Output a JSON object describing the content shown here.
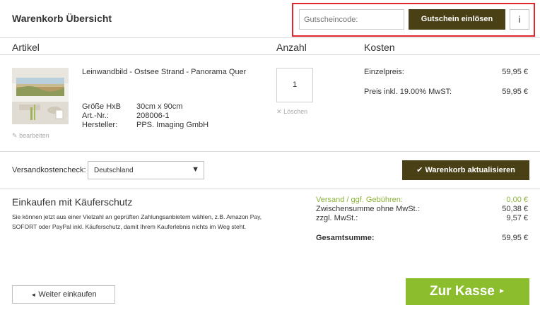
{
  "header": {
    "title": "Warenkorb Übersicht",
    "coupon_placeholder": "Gutscheincode:",
    "coupon_button": "Gutschein einlösen",
    "info_button": "i"
  },
  "columns": {
    "article": "Artikel",
    "quantity": "Anzahl",
    "costs": "Kosten"
  },
  "product": {
    "name": "Leinwandbild - Ostsee Strand - Panorama Quer",
    "specs": [
      {
        "label": "Größe HxB",
        "value": "30cm x 90cm"
      },
      {
        "label": "Art.-Nr.:",
        "value": "208006-1"
      },
      {
        "label": "Hersteller:",
        "value": "PPS. Imaging GmbH"
      }
    ],
    "edit_label": "bearbeiten",
    "quantity": "1",
    "delete_label": "Löschen",
    "unit_price_label": "Einzelpreis:",
    "unit_price": "59,95 €",
    "price_incl_label": "Preis inkl. 19.00% MwST:",
    "price_incl": "59,95 €"
  },
  "shipping": {
    "label": "Versandkostencheck:",
    "selected_country": "Deutschland",
    "update_button": "Warenkorb aktualisieren"
  },
  "protection": {
    "title": "Einkaufen mit Käuferschutz",
    "text": "Sie können jetzt aus einer Vielzahl an geprüften Zahlungsanbietern wählen, z.B. Amazon Pay, SOFORT oder PayPal inkl. Käuferschutz, damit Ihrem Kauferlebnis nichts im Weg steht."
  },
  "summary": {
    "shipping_label": "Versand / ggf. Gebühren:",
    "shipping_value": "0,00 €",
    "subtotal_label": "Zwischensumme ohne MwSt.:",
    "subtotal_value": "50,38 €",
    "vat_label": "zzgl. MwSt.:",
    "vat_value": "9,57 €",
    "total_label": "Gesamtsumme:",
    "total_value": "59,95 €"
  },
  "footer": {
    "back_button": "Weiter einkaufen",
    "checkout_button": "Zur Kasse"
  },
  "colors": {
    "accent_dark": "#4a4015",
    "accent_green": "#8cbd2c",
    "highlight_red": "#e0262d"
  }
}
